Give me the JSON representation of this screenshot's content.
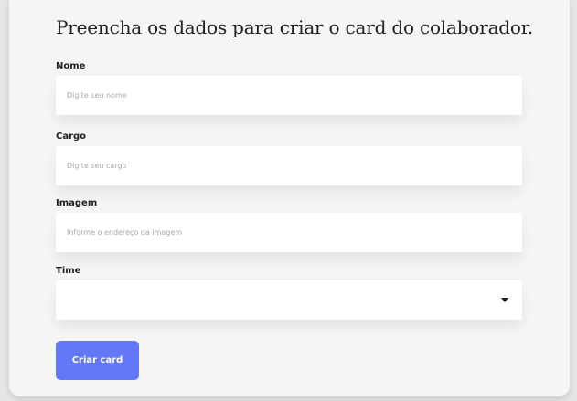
{
  "form": {
    "title": "Preencha os dados para criar o card do colaborador.",
    "fields": [
      {
        "label": "Nome",
        "placeholder": "Digite seu nome"
      },
      {
        "label": "Cargo",
        "placeholder": "Digite seu cargo"
      },
      {
        "label": "Imagem",
        "placeholder": "Informe o endereço da imagem"
      }
    ],
    "team": {
      "label": "Time",
      "selected": ""
    },
    "submit_label": "Criar card"
  },
  "colors": {
    "background": "#e6e6e6",
    "card": "#f5f5f5",
    "button": "#6278f7",
    "text": "#212121",
    "placeholder": "#a8a8a8"
  }
}
